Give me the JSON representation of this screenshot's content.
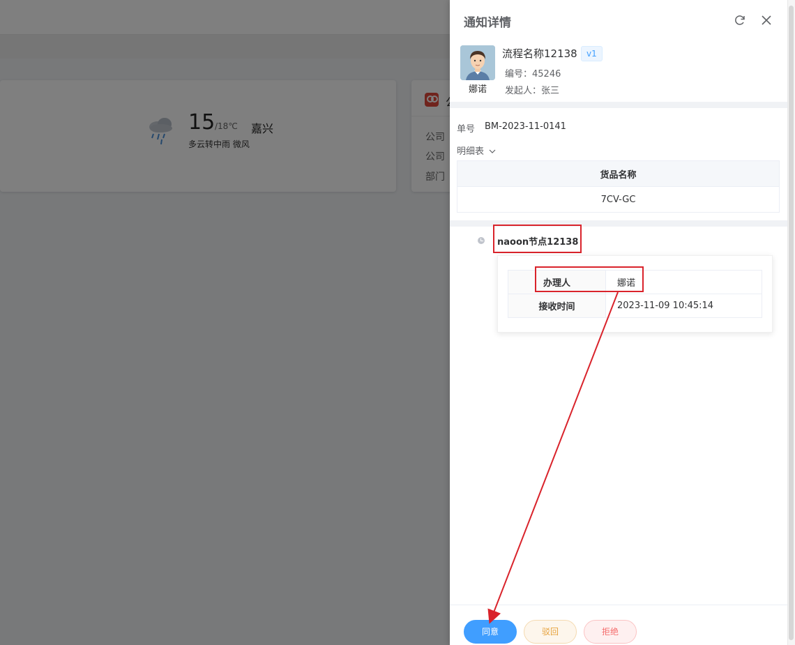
{
  "background": {
    "weather": {
      "temperature": "15",
      "range": "/18℃",
      "city": "嘉兴",
      "description": "多云转中雨 微风",
      "icon": "rain-cloud-icon"
    },
    "notice_card": {
      "title": "公",
      "rows": [
        "公司",
        "公司",
        "部门"
      ]
    }
  },
  "drawer": {
    "title": "通知详情",
    "refresh_icon": "refresh-icon",
    "close_icon": "close-icon",
    "avatar_name": "娜诺",
    "flow_name": "流程名称12138",
    "version": "v1",
    "number": "编号：45246",
    "starter": "发起人：张三",
    "doc_no_label": "单号",
    "doc_no_value": "BM-2023-11-0141",
    "detail_toggle": "明细表",
    "detail_table": {
      "header": "货品名称",
      "rows": [
        "7CV-GC"
      ]
    },
    "node": {
      "name": "naoon节点12138",
      "handler_label": "办理人",
      "handler_value": "娜诺",
      "time_label": "接收时间",
      "time_value": "2023-11-09 10:45:14"
    },
    "buttons": {
      "agree": "同意",
      "reject": "驳回",
      "refuse": "拒绝"
    }
  },
  "colors": {
    "primary": "#409eff",
    "warning": "#e6a23c",
    "danger": "#f56c6c",
    "annotation": "#d9232b"
  }
}
